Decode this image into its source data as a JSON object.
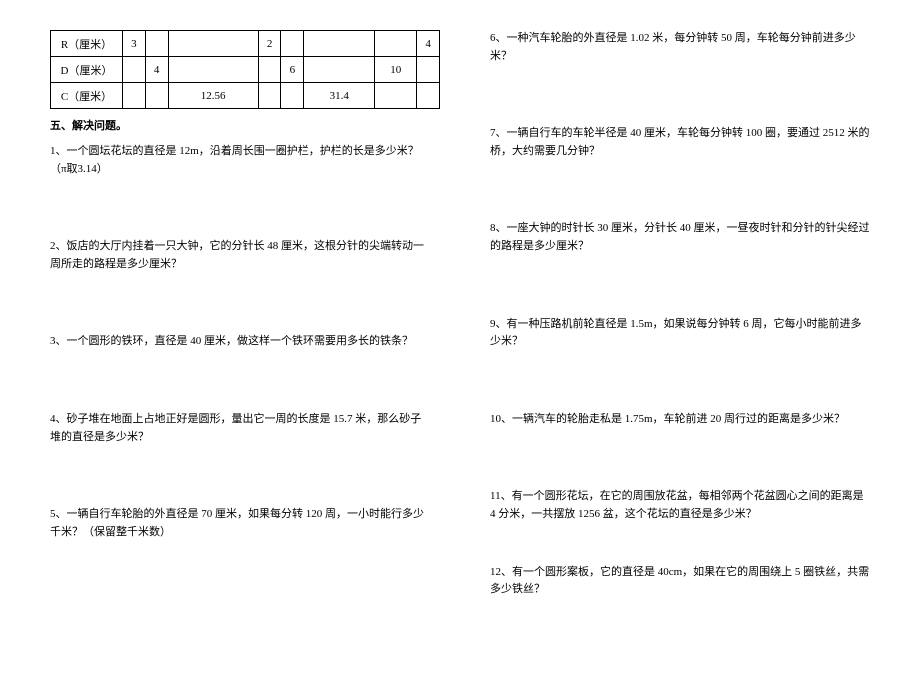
{
  "table": {
    "rows": [
      {
        "label": "R（厘米）",
        "c1": "3",
        "c2": "",
        "c3": "",
        "c4": "2",
        "c5": "",
        "c6": "",
        "c7": "",
        "c8": "4"
      },
      {
        "label": "D（厘米）",
        "c1": "",
        "c2": "4",
        "c3": "",
        "c4": "",
        "c5": "6",
        "c6": "",
        "c7": "10",
        "c8": ""
      },
      {
        "label": "C（厘米）",
        "c1": "",
        "c2": "",
        "c3": "12.56",
        "c4": "",
        "c5": "",
        "c6": "31.4",
        "c7": "",
        "c8": ""
      }
    ]
  },
  "section_title": "五、解决问题。",
  "left": {
    "q1": "1、一个圆坛花坛的直径是 12m，沿着周长围一圈护栏，护栏的长是多少米？（π取3.14）",
    "q2": "2、饭店的大厅内挂着一只大钟，它的分针长 48 厘米，这根分针的尖端转动一周所走的路程是多少厘米？",
    "q3": "3、一个圆形的铁环，直径是 40 厘米，做这样一个铁环需要用多长的铁条？",
    "q4": "4、砂子堆在地面上占地正好是圆形，量出它一周的长度是 15.7 米，那么砂子堆的直径是多少米？",
    "q5": "5、一辆自行车轮胎的外直径是 70 厘米，如果每分转 120 周，一小时能行多少千米？（保留整千米数）"
  },
  "right": {
    "q6": "6、一种汽车轮胎的外直径是 1.02 米，每分钟转 50 周，车轮每分钟前进多少米？",
    "q7": "7、一辆自行车的车轮半径是 40 厘米，车轮每分钟转 100 圈，要通过 2512 米的桥，大约需要几分钟？",
    "q8": "8、一座大钟的时针长 30 厘米，分针长 40 厘米，一昼夜时针和分针的针尖经过的路程是多少厘米？",
    "q9": "9、有一种压路机前轮直径是 1.5m，如果说每分钟转 6 周，它每小时能前进多少米？",
    "q10": "10、一辆汽车的轮胎走私是 1.75m，车轮前进 20 周行过的距离是多少米？",
    "q11": "11、有一个圆形花坛，在它的周围放花盆，每相邻两个花盆圆心之间的距离是 4 分米，一共摆放 1256 盆，这个花坛的直径是多少米？",
    "q12": "12、有一个圆形案板，它的直径是 40cm，如果在它的周围绕上 5 圈铁丝，共需多少铁丝？"
  }
}
